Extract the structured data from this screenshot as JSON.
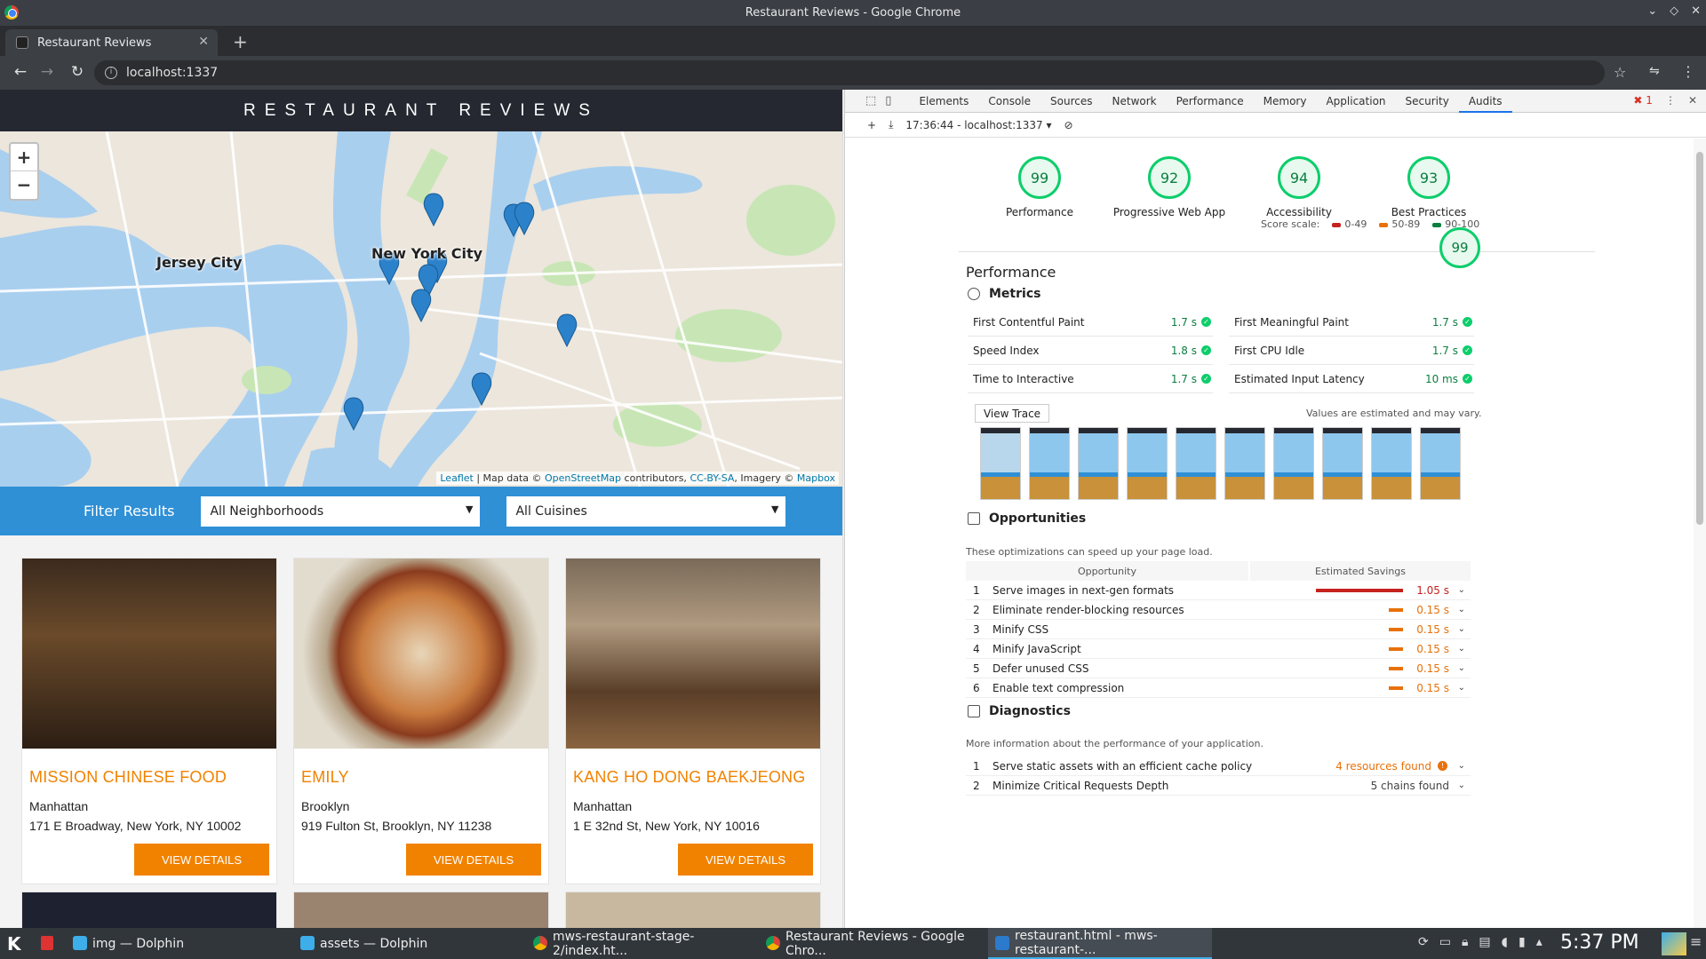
{
  "window": {
    "title": "Restaurant Reviews - Google Chrome"
  },
  "browser": {
    "tab_title": "Restaurant Reviews",
    "url": "localhost:1337"
  },
  "site": {
    "header": "RESTAURANT REVIEWS",
    "map": {
      "labels": [
        "Jersey City",
        "New York City"
      ],
      "attribution": {
        "leaflet": "Leaflet",
        "sep1": " | Map data © ",
        "osm": "OpenStreetMap",
        "sep2": " contributors, ",
        "cc": "CC-BY-SA",
        "sep3": ", Imagery © ",
        "mapbox": "Mapbox"
      },
      "zoom_in": "+",
      "zoom_out": "−"
    },
    "filter": {
      "label": "Filter Results",
      "neighborhood": "All Neighborhoods",
      "cuisine": "All Cuisines"
    },
    "restaurants": [
      {
        "name": "MISSION CHINESE FOOD",
        "neighborhood": "Manhattan",
        "address": "171 E Broadway, New York, NY 10002",
        "button": "VIEW DETAILS"
      },
      {
        "name": "EMILY",
        "neighborhood": "Brooklyn",
        "address": "919 Fulton St, Brooklyn, NY 11238",
        "button": "VIEW DETAILS"
      },
      {
        "name": "KANG HO DONG BAEKJEONG",
        "neighborhood": "Manhattan",
        "address": "1 E 32nd St, New York, NY 10016",
        "button": "VIEW DETAILS"
      }
    ]
  },
  "devtools": {
    "tabs": [
      "Elements",
      "Console",
      "Sources",
      "Network",
      "Performance",
      "Memory",
      "Application",
      "Security",
      "Audits"
    ],
    "active_tab": "Audits",
    "error_count": "1",
    "run_label": "17:36:44 - localhost:1337",
    "gauges": [
      {
        "score": "99",
        "label": "Performance"
      },
      {
        "score": "92",
        "label": "Progressive Web App"
      },
      {
        "score": "94",
        "label": "Accessibility"
      },
      {
        "score": "93",
        "label": "Best Practices"
      }
    ],
    "score_scale": {
      "label": "Score scale:",
      "low": "0-49",
      "mid": "50-89",
      "high": "90-100"
    },
    "performance": {
      "title": "Performance",
      "score": "99",
      "metrics_title": "Metrics",
      "metrics": [
        {
          "name": "First Contentful Paint",
          "value": "1.7 s"
        },
        {
          "name": "First Meaningful Paint",
          "value": "1.7 s"
        },
        {
          "name": "Speed Index",
          "value": "1.8 s"
        },
        {
          "name": "First CPU Idle",
          "value": "1.7 s"
        },
        {
          "name": "Time to Interactive",
          "value": "1.7 s"
        },
        {
          "name": "Estimated Input Latency",
          "value": "10 ms"
        }
      ],
      "view_trace": "View Trace",
      "estimate_note": "Values are estimated and may vary.",
      "filmstrip_frames": 10
    },
    "opportunities": {
      "title": "Opportunities",
      "description": "These optimizations can speed up your page load.",
      "col_opportunity": "Opportunity",
      "col_savings": "Estimated Savings",
      "rows": [
        {
          "num": "1",
          "name": "Serve images in next-gen formats",
          "savings": "1.05 s",
          "level": 1.0,
          "color": "#c5221f"
        },
        {
          "num": "2",
          "name": "Eliminate render-blocking resources",
          "savings": "0.15 s",
          "level": 0.15,
          "color": "#e8710a"
        },
        {
          "num": "3",
          "name": "Minify CSS",
          "savings": "0.15 s",
          "level": 0.15,
          "color": "#e8710a"
        },
        {
          "num": "4",
          "name": "Minify JavaScript",
          "savings": "0.15 s",
          "level": 0.15,
          "color": "#e8710a"
        },
        {
          "num": "5",
          "name": "Defer unused CSS",
          "savings": "0.15 s",
          "level": 0.15,
          "color": "#e8710a"
        },
        {
          "num": "6",
          "name": "Enable text compression",
          "savings": "0.15 s",
          "level": 0.15,
          "color": "#e8710a"
        }
      ]
    },
    "diagnostics": {
      "title": "Diagnostics",
      "description": "More information about the performance of your application.",
      "rows": [
        {
          "num": "1",
          "name": "Serve static assets with an efficient cache policy",
          "value": "4 resources found"
        },
        {
          "num": "2",
          "name": "Minimize Critical Requests Depth",
          "value": "5 chains found"
        }
      ]
    }
  },
  "taskbar": {
    "items": [
      {
        "label": "img — Dolphin"
      },
      {
        "label": "assets — Dolphin"
      },
      {
        "label": "mws-restaurant-stage-2/index.ht..."
      },
      {
        "label": "Restaurant Reviews - Google Chro..."
      },
      {
        "label": "restaurant.html - mws-restaurant-..."
      }
    ],
    "clock": "5:37 PM"
  },
  "colors": {
    "accent": "#f18200",
    "filter_bar": "#2f90d6",
    "pass": "#0cce6b"
  }
}
